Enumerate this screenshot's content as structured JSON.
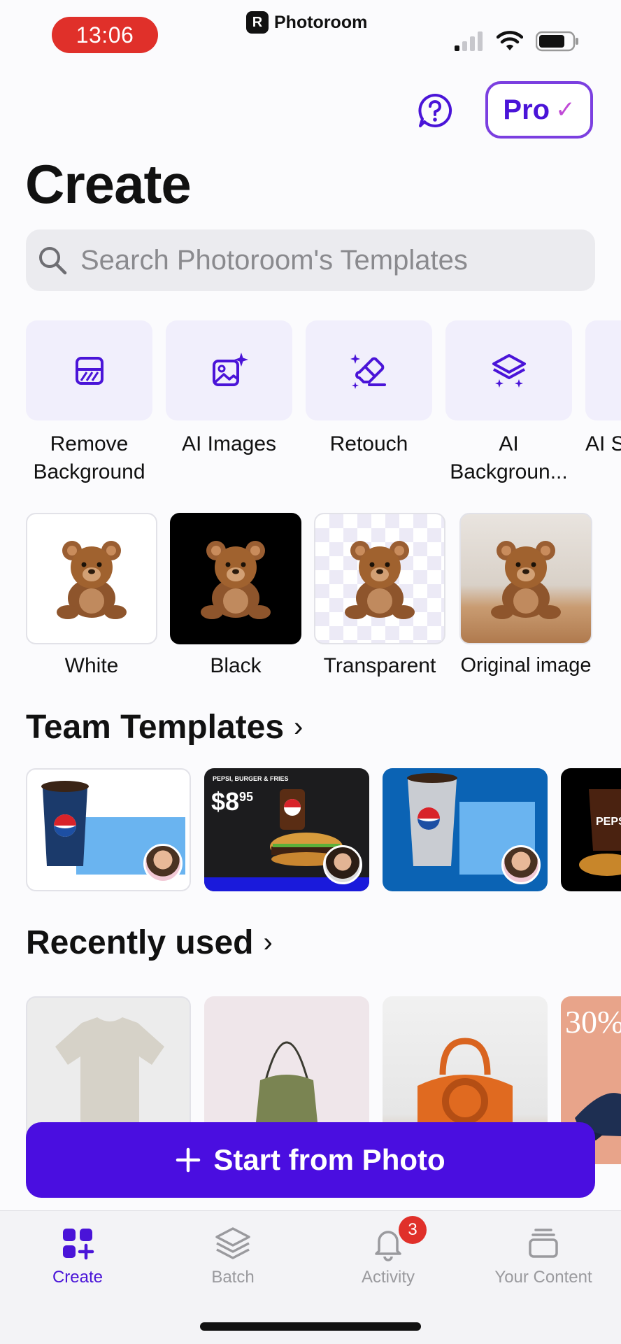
{
  "status": {
    "time": "13:06",
    "app_name": "Photoroom",
    "app_logo_letter": "R"
  },
  "header": {
    "help_icon": "question-mark-bubble-icon",
    "pro_label": "Pro",
    "pro_check": "✓",
    "title": "Create"
  },
  "search": {
    "placeholder": "Search Photoroom's Templates",
    "icon": "search-icon"
  },
  "tools": [
    {
      "label": "Remove Background",
      "icon": "remove-background-icon"
    },
    {
      "label": "AI Images",
      "icon": "ai-images-icon"
    },
    {
      "label": "Retouch",
      "icon": "retouch-eraser-icon"
    },
    {
      "label": "AI Backgroun...",
      "icon": "ai-backgrounds-layers-icon"
    },
    {
      "label": "AI S",
      "icon": "ai-tool-icon"
    }
  ],
  "presets": [
    {
      "label": "White"
    },
    {
      "label": "Black"
    },
    {
      "label": "Transparent"
    },
    {
      "label": "Original image"
    }
  ],
  "team_templates": {
    "title": "Team Templates",
    "chevron": "›",
    "cards": [
      {
        "caption": ""
      },
      {
        "caption": "PEPSI, BURGER & FRIES",
        "price_main": "$8",
        "price_cents": "95"
      },
      {
        "caption": ""
      },
      {
        "caption": "PEPS"
      }
    ]
  },
  "recently_used": {
    "title": "Recently used",
    "chevron": "›",
    "promo_text": "30%"
  },
  "cta": {
    "icon": "plus-icon",
    "label": "Start from Photo"
  },
  "tabbar": {
    "tabs": [
      {
        "label": "Create",
        "icon": "create-grid-plus-icon",
        "active": true
      },
      {
        "label": "Batch",
        "icon": "layers-icon"
      },
      {
        "label": "Activity",
        "icon": "bell-icon",
        "badge": "3"
      },
      {
        "label": "Your Content",
        "icon": "stack-icon"
      }
    ]
  },
  "colors": {
    "accent": "#4a0ee0",
    "badge": "#e0302a",
    "pro_border": "#7b3fe0",
    "tile_bg": "#f1effc"
  }
}
